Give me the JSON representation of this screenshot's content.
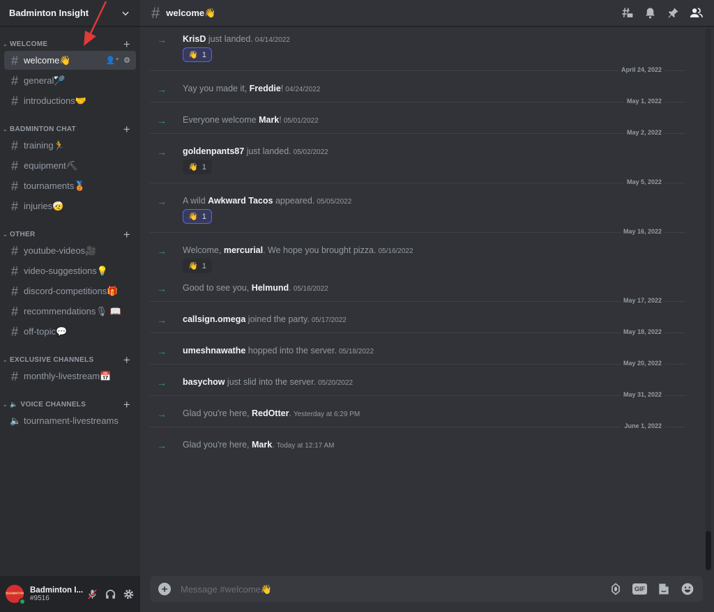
{
  "server": {
    "name": "Badminton Insight"
  },
  "sidebar": {
    "categories": [
      {
        "label": "WELCOME",
        "channels": [
          {
            "name": "welcome👋",
            "active": true
          },
          {
            "name": "general🏸"
          },
          {
            "name": "introductions🤝"
          }
        ]
      },
      {
        "label": "BADMINTON CHAT",
        "channels": [
          {
            "name": "training🏃"
          },
          {
            "name": "equipment⛏"
          },
          {
            "name": "tournaments🥉"
          },
          {
            "name": "injuries🤕"
          }
        ]
      },
      {
        "label": "OTHER",
        "channels": [
          {
            "name": "youtube-videos🎥"
          },
          {
            "name": "video-suggestions💡"
          },
          {
            "name": "discord-competitions🎁"
          },
          {
            "name": "recommendations🎙 📖"
          },
          {
            "name": "off-topic💬"
          }
        ]
      },
      {
        "label": "EXCLUSIVE CHANNELS",
        "channels": [
          {
            "name": "monthly-livestream📅"
          }
        ]
      },
      {
        "label": "VOICE CHANNELS",
        "channels": [
          {
            "name": "tournament-livestreams"
          }
        ]
      }
    ]
  },
  "user": {
    "name": "Badminton I...",
    "tag": "#9516",
    "avatar_text": "BADMINTON"
  },
  "header": {
    "channel": "welcome👋"
  },
  "messages": [
    {
      "type": "msg",
      "pre": "",
      "user": "KrisD",
      "post": " just landed.",
      "ts": "04/14/2022",
      "reaction": {
        "emoji": "👋",
        "count": "1",
        "me": true
      }
    },
    {
      "type": "divider",
      "label": "April 24, 2022"
    },
    {
      "type": "msg",
      "pre": "Yay you made it, ",
      "user": "Freddie",
      "post": "!",
      "ts": "04/24/2022"
    },
    {
      "type": "divider",
      "label": "May 1, 2022"
    },
    {
      "type": "msg",
      "pre": "Everyone welcome ",
      "user": "Mark",
      "post": "!",
      "ts": "05/01/2022"
    },
    {
      "type": "divider",
      "label": "May 2, 2022"
    },
    {
      "type": "msg",
      "pre": "",
      "user": "goldenpants87",
      "post": " just landed.",
      "ts": "05/02/2022",
      "reaction": {
        "emoji": "👋",
        "count": "1",
        "me": false
      }
    },
    {
      "type": "divider",
      "label": "May 5, 2022"
    },
    {
      "type": "msg",
      "pre": "A wild ",
      "user": "Awkward Tacos",
      "post": " appeared.",
      "ts": "05/05/2022",
      "reaction": {
        "emoji": "👋",
        "count": "1",
        "me": true
      }
    },
    {
      "type": "divider",
      "label": "May 16, 2022"
    },
    {
      "type": "msg",
      "pre": "Welcome, ",
      "user": "mercurial",
      "post": ". We hope you brought pizza.",
      "ts": "05/16/2022",
      "reaction": {
        "emoji": "👋",
        "count": "1",
        "me": false
      }
    },
    {
      "type": "msg",
      "pre": "Good to see you, ",
      "user": "Helmund",
      "post": ".",
      "ts": "05/16/2022"
    },
    {
      "type": "divider",
      "label": "May 17, 2022"
    },
    {
      "type": "msg",
      "pre": "",
      "user": "callsign.omega",
      "post": " joined the party.",
      "ts": "05/17/2022"
    },
    {
      "type": "divider",
      "label": "May 18, 2022"
    },
    {
      "type": "msg",
      "pre": "",
      "user": "umeshnawathe",
      "post": " hopped into the server.",
      "ts": "05/18/2022"
    },
    {
      "type": "divider",
      "label": "May 20, 2022"
    },
    {
      "type": "msg",
      "pre": "",
      "user": "basychow",
      "post": " just slid into the server.",
      "ts": "05/20/2022"
    },
    {
      "type": "divider",
      "label": "May 31, 2022"
    },
    {
      "type": "msg",
      "pre": "Glad you're here, ",
      "user": "RedOtter",
      "post": ".",
      "ts": "Yesterday at 6:29 PM"
    },
    {
      "type": "divider",
      "label": "June 1, 2022"
    },
    {
      "type": "msg",
      "pre": "Glad you're here, ",
      "user": "Mark",
      "post": ".",
      "ts": "Today at 12:17 AM"
    }
  ],
  "composer": {
    "placeholder": "Message #welcome👋",
    "gif_label": "GIF"
  },
  "icons": {
    "arrow": "→",
    "hash": "#",
    "plus": "+",
    "cat_chevron": "⌄"
  },
  "colors": {
    "accent": "#5865f2",
    "join_arrow": "#23a55a",
    "annotation": "#e03a3a"
  }
}
